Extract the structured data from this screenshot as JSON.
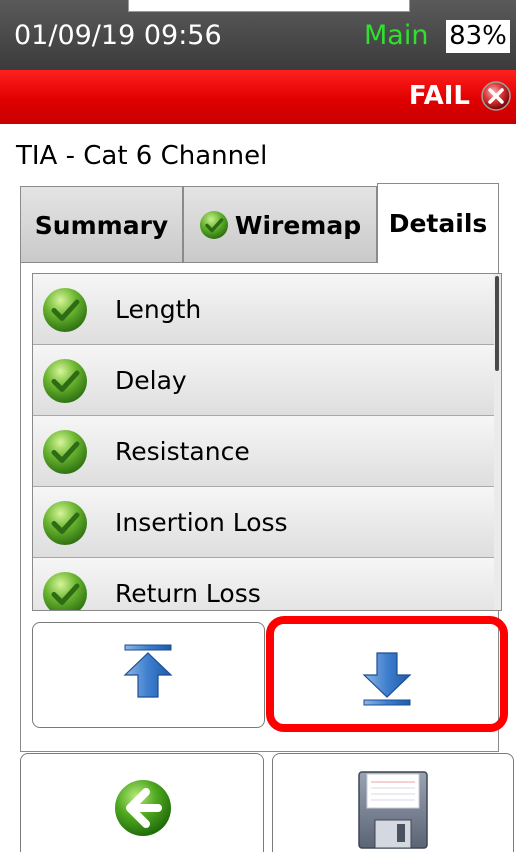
{
  "status_bar": {
    "datetime": "01/09/19 09:56",
    "mode": "Main",
    "battery": "83%",
    "mode_color": "#2fe02f"
  },
  "result_bar": {
    "status": "FAIL",
    "icon": "fail-x-icon",
    "color": "#e00000"
  },
  "test": {
    "title": "TIA - Cat 6 Channel"
  },
  "tabs": [
    {
      "label": "Summary",
      "selected": false
    },
    {
      "label": "Wiremap",
      "icon": "check-icon",
      "selected": false
    },
    {
      "label": "Details",
      "selected": true
    }
  ],
  "results": [
    {
      "label": "Length",
      "status": "pass",
      "icon": "pass-check-icon"
    },
    {
      "label": "Delay",
      "status": "pass",
      "icon": "pass-check-icon"
    },
    {
      "label": "Resistance",
      "status": "pass",
      "icon": "pass-check-icon"
    },
    {
      "label": "Insertion Loss",
      "status": "pass",
      "icon": "pass-check-icon"
    },
    {
      "label": "Return Loss",
      "status": "pass",
      "icon": "pass-check-icon"
    }
  ],
  "controls": {
    "scroll_top_icon": "scroll-to-top-icon",
    "scroll_bottom_icon": "scroll-to-bottom-icon",
    "back_icon": "back-arrow-icon",
    "save_icon": "save-disk-icon",
    "highlight_color": "#ff0000"
  }
}
